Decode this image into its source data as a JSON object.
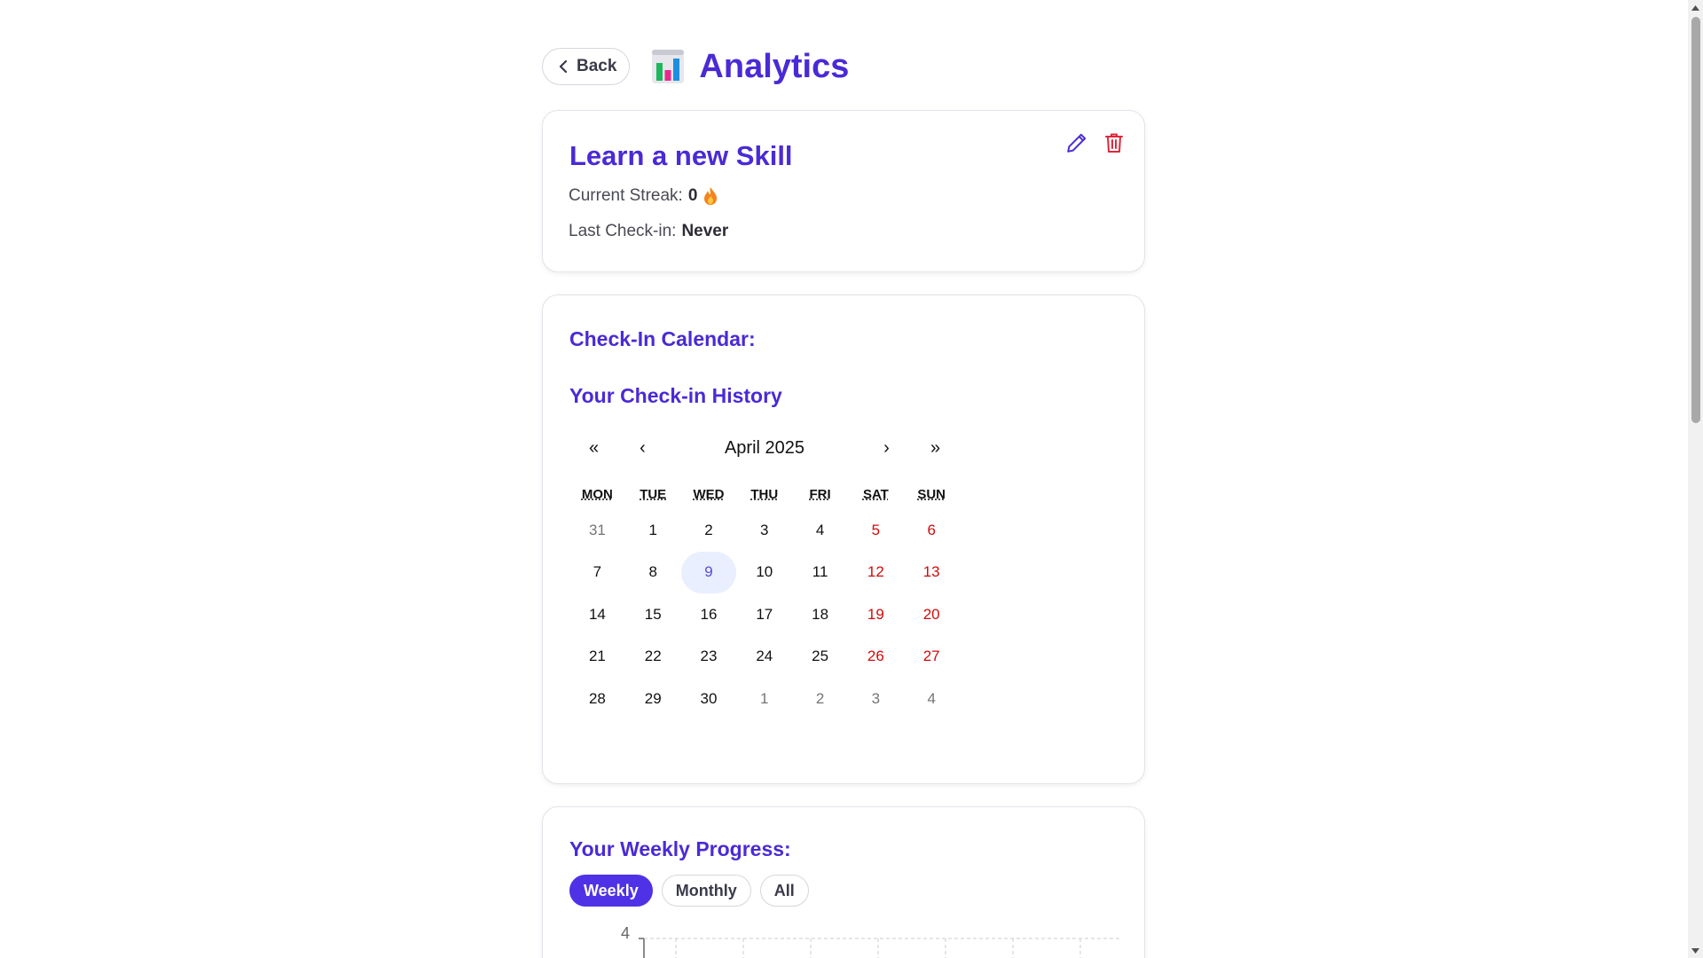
{
  "header": {
    "back_label": "Back",
    "title": "Analytics"
  },
  "habit": {
    "name": "Learn a new Skill",
    "streak_label": "Current Streak:",
    "streak_value": "0",
    "checkin_label": "Last Check-in:",
    "checkin_value": "Never"
  },
  "calendar": {
    "section_title": "Check-In Calendar:",
    "history_title": "Your Check-in History",
    "prev_year": "«",
    "prev_month": "‹",
    "month_label": "April 2025",
    "next_month": "›",
    "next_year": "»",
    "weekdays": [
      "MON",
      "TUE",
      "WED",
      "THU",
      "FRI",
      "SAT",
      "SUN"
    ],
    "weeks": [
      [
        "31",
        "1",
        "2",
        "3",
        "4",
        "5",
        "6"
      ],
      [
        "7",
        "8",
        "9",
        "10",
        "11",
        "12",
        "13"
      ],
      [
        "14",
        "15",
        "16",
        "17",
        "18",
        "19",
        "20"
      ],
      [
        "21",
        "22",
        "23",
        "24",
        "25",
        "26",
        "27"
      ],
      [
        "28",
        "29",
        "30",
        "1",
        "2",
        "3",
        "4"
      ]
    ],
    "today": "9"
  },
  "progress": {
    "title": "Your Weekly Progress:",
    "tabs": [
      "Weekly",
      "Monthly",
      "All"
    ],
    "active_tab": "Weekly",
    "y_top_tick": "4"
  },
  "colors": {
    "accent": "#4a2ad6",
    "weekend": "#d10b0b",
    "delete": "#e0263a"
  },
  "icons": {
    "back": "chevron-left-icon",
    "title": "bar-chart-icon",
    "edit": "pencil-icon",
    "delete": "trash-icon",
    "streak": "fire-icon"
  }
}
